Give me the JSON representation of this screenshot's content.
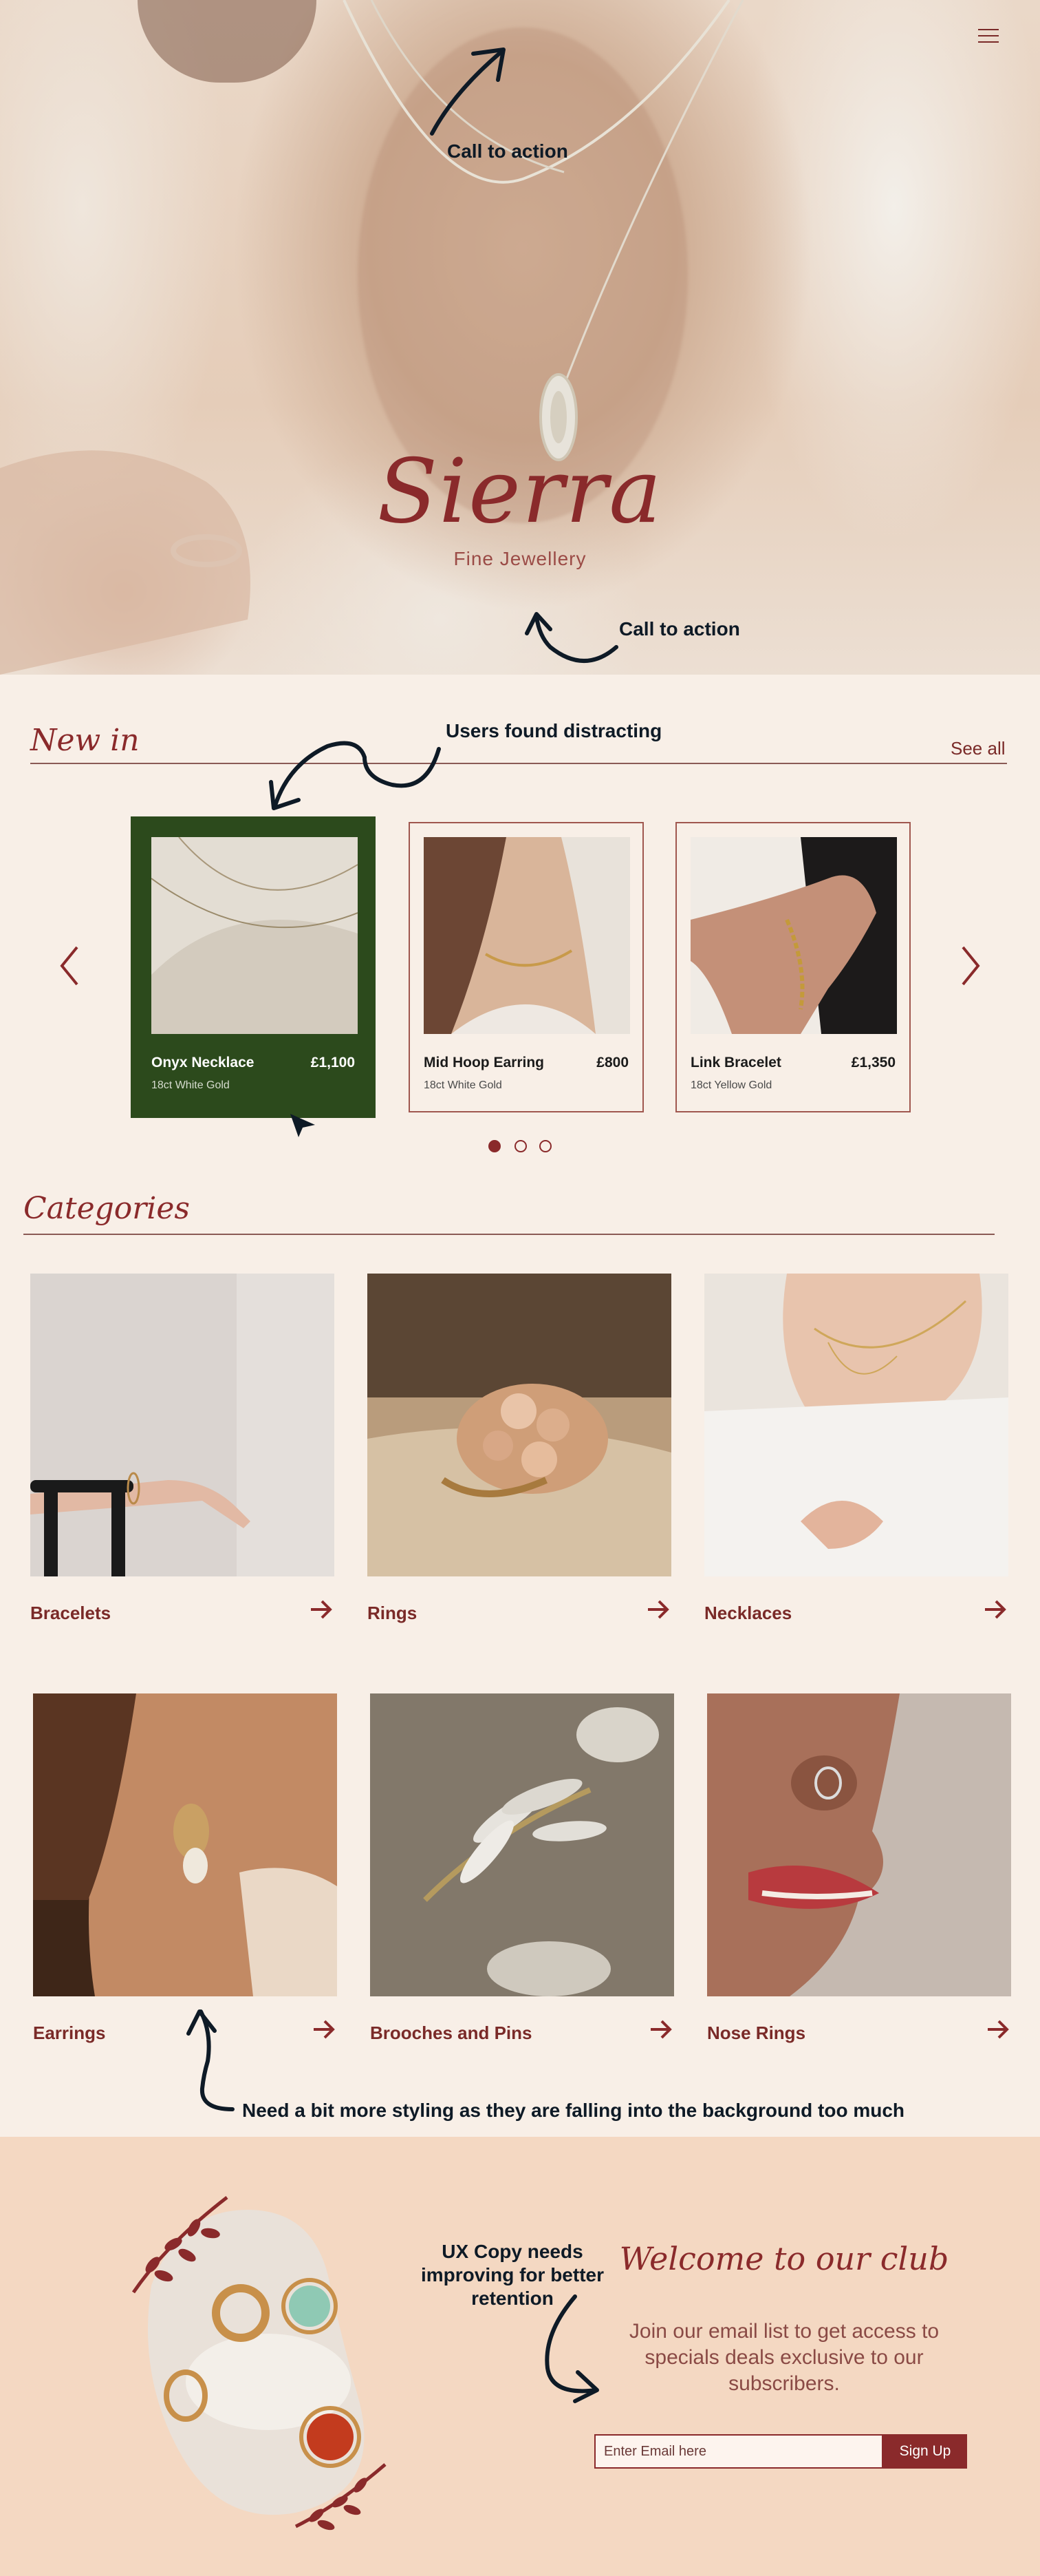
{
  "hero": {
    "brand": "Sierra",
    "tagline": "Fine Jewellery",
    "note_top": "Call to action",
    "note_bottom": "Call to action"
  },
  "new_in": {
    "title": "New in",
    "see_all": "See all",
    "note": "Users found distracting",
    "products": [
      {
        "name": "Onyx Necklace",
        "price": "£1,100",
        "metal": "18ct White Gold"
      },
      {
        "name": "Mid Hoop Earring",
        "price": "£800",
        "metal": "18ct White Gold"
      },
      {
        "name": "Link Bracelet",
        "price": "£1,350",
        "metal": "18ct Yellow Gold"
      }
    ],
    "pagination": {
      "pages": 3,
      "current": 1
    }
  },
  "categories": {
    "title": "Categories",
    "items": [
      {
        "label": "Bracelets"
      },
      {
        "label": "Rings"
      },
      {
        "label": "Necklaces"
      },
      {
        "label": "Earrings"
      },
      {
        "label": "Brooches and Pins"
      },
      {
        "label": "Nose Rings"
      }
    ],
    "note": "Need a bit more styling as they are falling into the background too much"
  },
  "club": {
    "title": "Welcome to our club",
    "body": "Join our email list to get access to specials deals exclusive to our subscribers.",
    "email_placeholder": "Enter Email here",
    "signup_label": "Sign Up",
    "note": "UX Copy needs improving for better retention"
  },
  "colors": {
    "brand": "#8a2a2b",
    "background": "#f8efe7",
    "active_card": "#2c4a1c",
    "club_background": "#f4d8c2",
    "annotation": "#0e1a26"
  }
}
